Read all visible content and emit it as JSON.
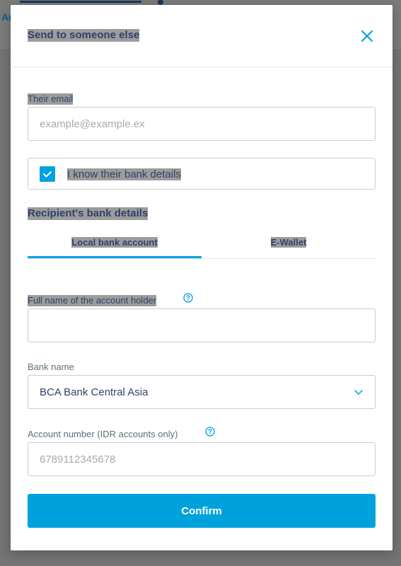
{
  "background": {
    "tab_text": "An"
  },
  "modal": {
    "title": "Send to someone else",
    "close_icon": "close-icon"
  },
  "email": {
    "label": "Their email",
    "placeholder": "example@example.ex",
    "value": ""
  },
  "bank_details_checkbox": {
    "label": "I know their bank details",
    "checked": true
  },
  "recipient_section": {
    "title": "Recipient's bank details",
    "tabs": [
      {
        "label": "Local bank account",
        "active": true
      },
      {
        "label": "E-Wallet",
        "active": false
      }
    ]
  },
  "full_name": {
    "label": "Full name of the account holder",
    "value": "",
    "help_icon": "question-circle-icon"
  },
  "bank_name": {
    "label": "Bank name",
    "selected": "BCA Bank Central Asia",
    "chevron_icon": "chevron-down-icon"
  },
  "account_number": {
    "label": "Account number (IDR accounts only)",
    "placeholder": "6789112345678",
    "value": "",
    "help_icon": "question-circle-icon"
  },
  "confirm": {
    "label": "Confirm"
  },
  "colors": {
    "accent": "#00a2dd",
    "text": "#2e4369",
    "muted": "#5d7079",
    "border": "#c9cbce",
    "overlay": "#747474"
  }
}
